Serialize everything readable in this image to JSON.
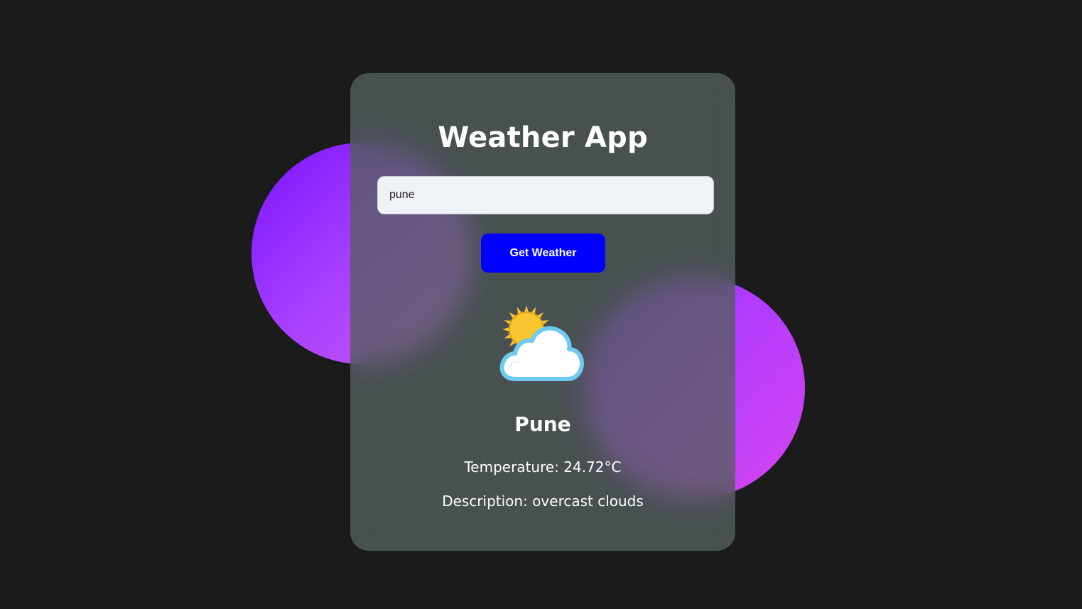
{
  "app": {
    "title": "Weather App"
  },
  "search": {
    "value": "pune",
    "placeholder": ""
  },
  "actions": {
    "get_weather_label": "Get Weather"
  },
  "result": {
    "icon": "partly-cloudy-icon",
    "city": "Pune",
    "temperature_label": "Temperature: 24.72°C",
    "description_label": "Description: overcast clouds"
  },
  "colors": {
    "background": "#1b1b1b",
    "card": "#495252",
    "button": "#0000ff",
    "input": "#eff3f8",
    "blob_start": "#7a12ff",
    "blob_end": "#cf5cf5"
  }
}
